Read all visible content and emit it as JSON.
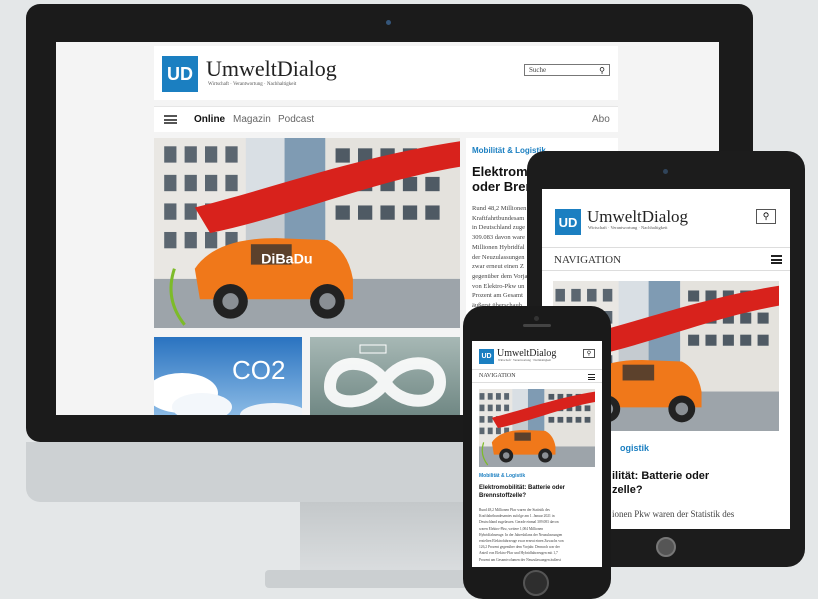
{
  "brand": {
    "logo_mark": "UD",
    "name": "UmweltDialog",
    "tagline": "Wirtschaft · Verantwortung · Nachhaltigkeit",
    "color": "#1b7fc1"
  },
  "desktop": {
    "search_placeholder": "Suche",
    "search_icon": "magnifier-icon",
    "nav": {
      "menu_icon": "hamburger-icon",
      "items": [
        "Online",
        "Magazin",
        "Podcast"
      ],
      "active": "Online",
      "right_item": "Abo"
    },
    "hero_article": {
      "kicker": "Mobilität & Logistik",
      "headline_lines": [
        "Elektromo",
        "oder Brenn"
      ],
      "body_lines": [
        "Rund 48,2 Millionen",
        "Kraftfahrtbundesam",
        "in Deutschland zuge",
        "309.083 davon ware",
        "Millionen Hybridfal",
        "der Neuzulassungen",
        "zwar erneut einen Z",
        "gegenüber dem Vorja",
        "von Elektro-Pkw un",
        "Prozent am Gesamt",
        "äußerst überschaub"
      ]
    },
    "tile_co2_text": "CO2",
    "car_badge": "DiBaDu"
  },
  "tablet": {
    "navigation_label": "NAVIGATION",
    "kicker_partial": "ogistik",
    "headline_lines": [
      "ilität: Batterie oder",
      "zelle?"
    ],
    "body_partial": "ionen Pkw waren der Statistik des"
  },
  "phone": {
    "navigation_label": "NAVIGATION",
    "kicker": "Mobilität & Logistik",
    "headline_lines": [
      "Elektromobilität: Batterie oder",
      "Brennstoffzelle?"
    ],
    "body_lines": [
      "Rund 48,2 Millionen Pkw waren der Statistik des",
      "Kraftfahrtbundesamtes zufolge am 1. Januar 2021 in",
      "Deutschland zugelassen. Gerade einmal 309.083 davon",
      "waren Elektro-Pkw, weitere 1,004 Millionen",
      "Hybridfahrzeuge. In der Jahresbilanz der Neuzulassungen",
      "erzielten Elektrofahrzeuge zwar erneut einen Zuwachs von",
      "126,2 Prozent gegenüber dem Vorjahr. Dennoch war der",
      "Anteil von Elektro-Pkw und Hybridfahrzeugen mit 1,7",
      "Prozent am Gesamtvolumen der Neuzulassungen äußerst"
    ]
  }
}
